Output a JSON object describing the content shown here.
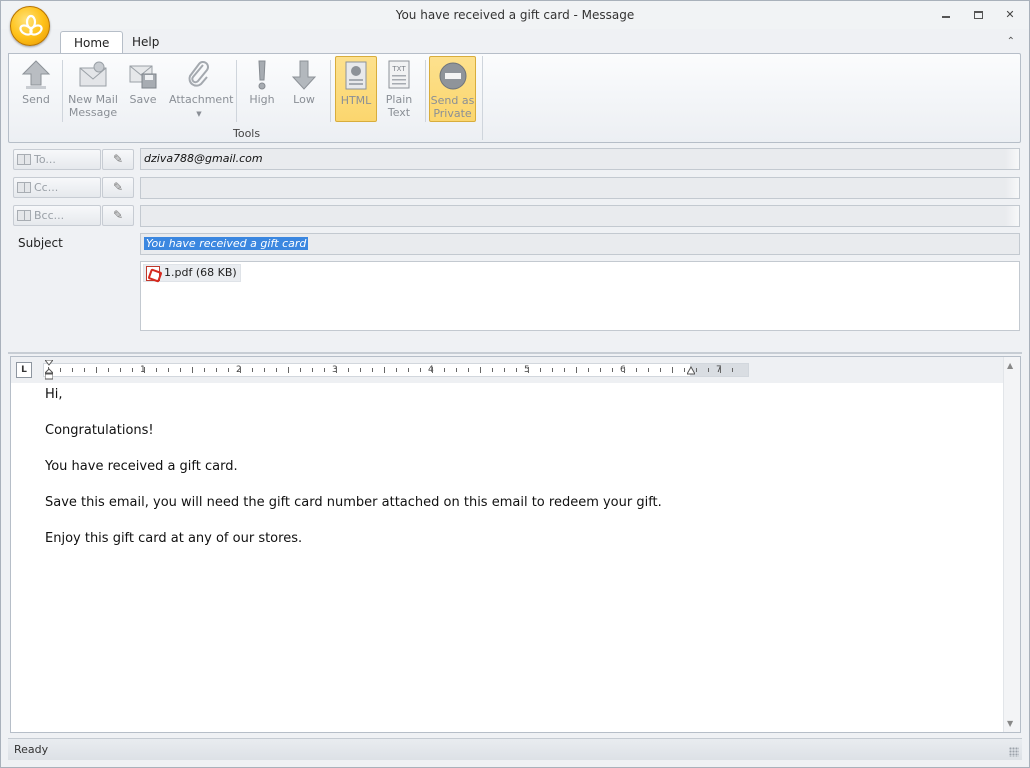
{
  "window": {
    "title": "You have received a gift card - Message",
    "minimize_glyph": "▭",
    "maximize_glyph": "▣",
    "close_glyph": "✕"
  },
  "tabs": [
    {
      "label": "Home",
      "active": true
    },
    {
      "label": "Help",
      "active": false
    }
  ],
  "ribbon": {
    "send": "Send",
    "new_mail_line1": "New Mail",
    "new_mail_line2": "Message",
    "save": "Save",
    "attachment": "Attachment",
    "high": "High",
    "low": "Low",
    "html": "HTML",
    "plain_line1": "Plain",
    "plain_line2": "Text",
    "private_line1": "Send as",
    "private_line2": "Private",
    "group_label": "Tools"
  },
  "header": {
    "to_label": "To...",
    "cc_label": "Cc...",
    "bcc_label": "Bcc...",
    "to_value": "dziva788@gmail.com",
    "cc_value": "",
    "bcc_value": "",
    "subject_label": "Subject",
    "subject_value": "You have received a gift card",
    "attachment": "1.pdf (68 KB)"
  },
  "ruler": {
    "numbers": [
      "1",
      "2",
      "3",
      "4",
      "5",
      "6",
      "7"
    ]
  },
  "body": {
    "line1": "Hi,",
    "line2": "Congratulations!",
    "line3": "You have received a gift card.",
    "line4": "Save this email, you will need the gift card number attached on this email to redeem your gift.",
    "line5": "Enjoy this gift card at any of our stores."
  },
  "status": {
    "text": "Ready"
  },
  "colors": {
    "accent": "#fbd66e",
    "selection": "#3b87e0",
    "orb": "#ffc21a"
  }
}
